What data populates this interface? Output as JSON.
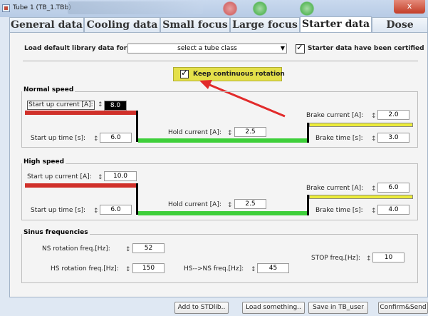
{
  "window": {
    "title": "Tube 1 (TB_1.TBb)",
    "close_glyph": "x"
  },
  "tabs": [
    {
      "label": "General data"
    },
    {
      "label": "Cooling data"
    },
    {
      "label": "Small focus"
    },
    {
      "label": "Large focus"
    },
    {
      "label": "Starter data",
      "active": true
    },
    {
      "label": "Dose data"
    }
  ],
  "library": {
    "load_label": "Load default library data for",
    "select_value": "select a tube class",
    "certified_label": "Starter data have been certified",
    "certified_checked": true
  },
  "keep_rotation": {
    "label": "Keep continuous rotation",
    "checked": true,
    "highlight_color": "#e4e04a"
  },
  "normal_speed": {
    "title": "Normal speed",
    "start_up_current_label": "Start up current [A]:",
    "start_up_current": "8.0",
    "start_up_time_label": "Start up time [s]:",
    "start_up_time": "6.0",
    "hold_current_label": "Hold current [A]:",
    "hold_current": "2.5",
    "brake_current_label": "Brake current [A]:",
    "brake_current": "2.0",
    "brake_time_label": "Brake time [s]:",
    "brake_time": "3.0"
  },
  "high_speed": {
    "title": "High speed",
    "start_up_current_label": "Start up current [A]:",
    "start_up_current": "10.0",
    "start_up_time_label": "Start up time [s]:",
    "start_up_time": "6.0",
    "hold_current_label": "Hold current [A]:",
    "hold_current": "2.5",
    "brake_current_label": "Brake current [A]:",
    "brake_current": "6.0",
    "brake_time_label": "Brake time [s]:",
    "brake_time": "4.0"
  },
  "sinus": {
    "title": "Sinus frequencies",
    "ns_label": "NS rotation freq.[Hz]:",
    "ns_value": "52",
    "hs_label": "HS rotation freq.[Hz]:",
    "hs_value": "150",
    "hs_ns_label": "HS-->NS freq.[Hz]:",
    "hs_ns_value": "45",
    "stop_label": "STOP freq.[Hz]:",
    "stop_value": "10"
  },
  "buttons": {
    "add_stdlib": "Add to STDlib..",
    "load_something": "Load something..",
    "save_tb_user": "Save in TB_user",
    "confirm_send": "Confirm&Send"
  },
  "spinner_glyph": "↕",
  "colors": {
    "start_bar": "#d0302a",
    "hold_bar": "#3ecf3a",
    "brake_bar": "#ecec3a",
    "arrow": "#e22b2b"
  }
}
